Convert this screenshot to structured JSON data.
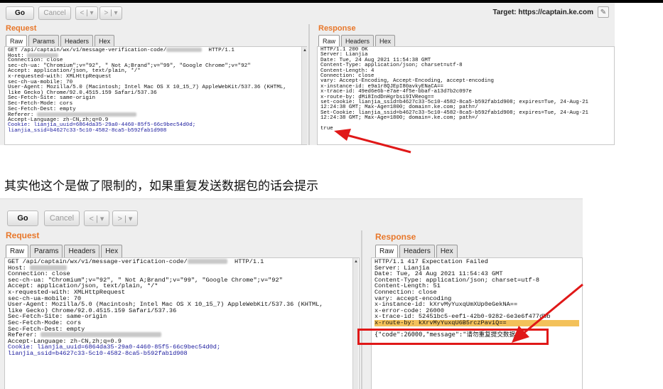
{
  "toolbar": {
    "go_label": "Go",
    "cancel_label": "Cancel",
    "back_label": "< | ▾",
    "forward_label": "> | ▾",
    "target_label": "Target: https://captain.ke.com"
  },
  "request": {
    "title": "Request",
    "tabs": [
      "Raw",
      "Params",
      "Headers",
      "Hex"
    ],
    "lines": [
      "GET /api/captain/wx/v1/message-verification-code/",
      "Host:",
      "Connection: close",
      "sec-ch-ua: \"Chromium\";v=\"92\", \" Not A;Brand\";v=\"99\", \"Google Chrome\";v=\"92\"",
      "Accept: application/json, text/plain, */*",
      "x-requested-with: XMLHttpRequest",
      "sec-ch-ua-mobile: 70",
      "User-Agent: Mozilla/5.0 (Macintosh; Intel Mac OS X 10_15_7) AppleWebKit/537.36 (KHTML,",
      "like Gecko) Chrome/92.0.4515.159 Safari/537.36",
      "Sec-Fetch-Site: same-origin",
      "Sec-Fetch-Mode: cors",
      "Sec-Fetch-Dest: empty",
      "Referer:",
      "Accept-Language: zh-CN,zh;q=0.9",
      "Cookie: lianjia_uuid=6864da35-29a0-4460-85f5-66c9bec54d0d;",
      "lianjia_ssid=b4627c33-5c10-4582-8ca5-b592fab1d908"
    ],
    "http_version": "HTTP/1.1"
  },
  "response1": {
    "title": "Response",
    "tabs": [
      "Raw",
      "Headers",
      "Hex"
    ],
    "lines": [
      "HTTP/1.1 200 OK",
      "Server: Lianjia",
      "Date: Tue, 24 Aug 2021 11:54:38 GMT",
      "Content-Type: application/json; charset=utf-8",
      "Content-Length: 4",
      "Connection: close",
      "vary: Accept-Encoding, Accept-Encoding, accept-encoding",
      "x-instance-id: e9a1r8QJEpI80avkyENaCA==",
      "x-trace-id: 49ed6e6b-e7ae-4f5e-bbaf-a13d7b2c097e",
      "x-route-by: dMi8IndDnHgrbsi9IVReog==",
      "set-cookie: lianjia_ssid=b4627c33-5c10-4582-8ca5-b592fab1d908; expires=Tue, 24-Aug-21",
      "12:24:38 GMT; Max-Age=1800; domain=.ke.com; path=/",
      "Set-Cookie: lianjia_ssid=b4627c33-5c10-4582-8ca5-b592fab1d908; expires=Tue, 24-Aug-21",
      "12:24:38 GMT; Max-Age=1800; domain=.ke.com; path=/",
      "",
      "true"
    ]
  },
  "caption": "其实他这个是做了限制的，如果重复发送数据包的话会提示",
  "response2": {
    "title": "Response",
    "tabs": [
      "Raw",
      "Headers",
      "Hex"
    ],
    "lines": [
      "HTTP/1.1 417 Expectation Failed",
      "Server: Lianjia",
      "Date: Tue, 24 Aug 2021 11:54:43 GMT",
      "Content-Type: application/json; charset=utf-8",
      "Content-Length: 51",
      "Connection: close",
      "vary: accept-encoding",
      "x-instance-id: kXrvMyYuxqUmXUp0eGekNA==",
      "x-error-code: 26000",
      "x-trace-id: 52451bc5-eef1-42b0-9282-6e3e6f477dbb",
      "x-route-by: kXrvMyYuxqU6B5rczPaviQ==",
      "",
      "{\"code\":26000,\"message\":\"请勿重复提交数据\"}"
    ]
  },
  "colors": {
    "pane_title": "#e8772a",
    "annotation_red": "#e01818",
    "highlight": "#f3c15a"
  }
}
